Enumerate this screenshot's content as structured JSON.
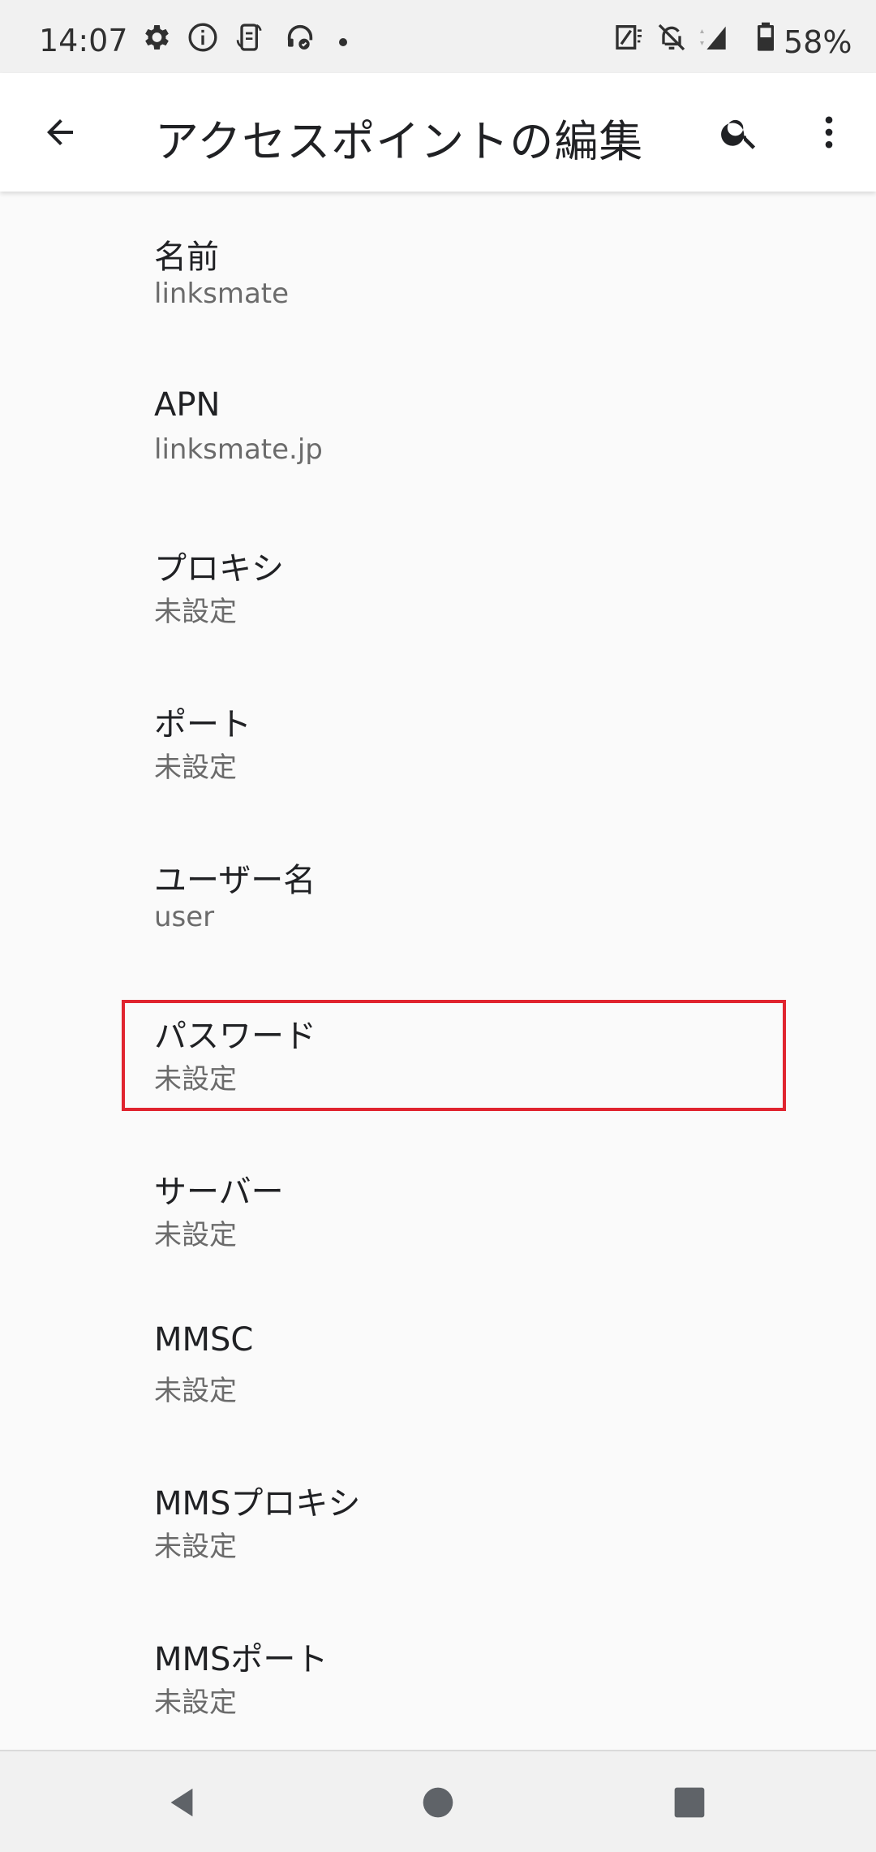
{
  "status_bar": {
    "time": "14:07",
    "battery_percent": "58%",
    "icons": [
      "gear-icon",
      "info-icon",
      "phone-sync-icon",
      "headset-icon",
      "notification-dot",
      "nfc-icon",
      "notifications-off-icon",
      "signal-icon",
      "battery-icon"
    ]
  },
  "app_bar": {
    "title": "アクセスポイントの編集",
    "icons": [
      "back-arrow-icon",
      "search-icon",
      "more-vert-icon"
    ]
  },
  "settings": [
    {
      "title": "名前",
      "summary": "linksmate"
    },
    {
      "title": "APN",
      "summary": "linksmate.jp"
    },
    {
      "title": "プロキシ",
      "summary": "未設定"
    },
    {
      "title": "ポート",
      "summary": "未設定"
    },
    {
      "title": "ユーザー名",
      "summary": "user"
    },
    {
      "title": "パスワード",
      "summary": "未設定"
    },
    {
      "title": "サーバー",
      "summary": "未設定"
    },
    {
      "title": "MMSC",
      "summary": "未設定"
    },
    {
      "title": "MMSプロキシ",
      "summary": "未設定"
    },
    {
      "title": "MMSポート",
      "summary": "未設定"
    }
  ],
  "highlight": {
    "target": "パスワード",
    "color": "#e0242f"
  },
  "nav_bar": {
    "icons": [
      "nav-back-icon",
      "nav-home-icon",
      "nav-recents-icon"
    ]
  },
  "colors": {
    "status_bar_bg": "#f1f1f1",
    "app_bar_bg": "#ffffff",
    "list_bg": "#fafafa"
  }
}
